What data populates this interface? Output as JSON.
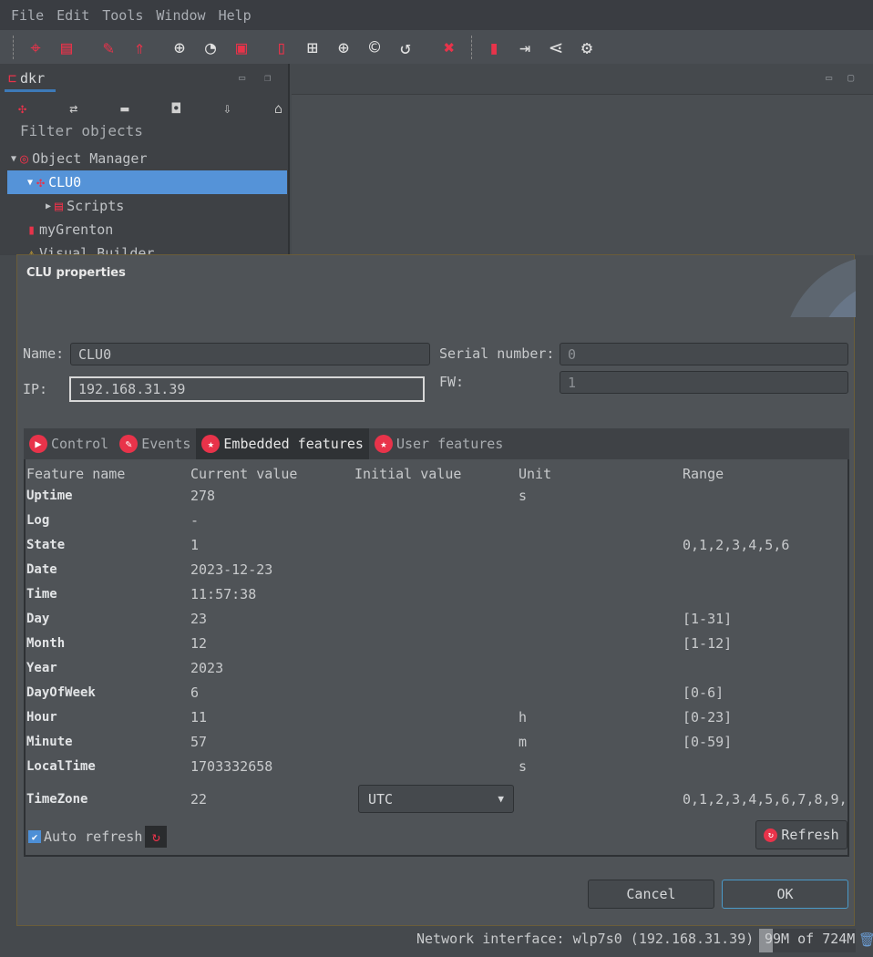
{
  "menu": [
    "File",
    "Edit",
    "Tools",
    "Window",
    "Help"
  ],
  "toolbar": {
    "icons": [
      "search-object-icon",
      "module-layout-icon",
      "pin-edit-icon",
      "upload-arrows-icon",
      "add-object-icon",
      "clock-icon",
      "add-script-icon",
      "mobile-refresh-icon",
      "object-tree-icon",
      "add-container-icon",
      "copyright-object-icon",
      "mobile-sync-icon",
      "delete-icon",
      "add-mobile-icon",
      "mobile-import-icon",
      "share-icon",
      "gear-icon"
    ]
  },
  "left_panel": {
    "tab": "dkr",
    "filter_placeholder": "Filter objects",
    "tree": [
      {
        "label": "Object Manager"
      },
      {
        "label": "CLU0"
      },
      {
        "label": "Scripts"
      },
      {
        "label": "myGrenton"
      },
      {
        "label": "Visual Builder"
      }
    ]
  },
  "dialog": {
    "title": "CLU properties",
    "name_label": "Name:",
    "name_value": "CLU0",
    "ip_label": "IP:",
    "ip_value": "192.168.31.39",
    "serial_label": "Serial number:",
    "serial_value": "0",
    "fw_label": "FW:",
    "fw_value": "1",
    "tabs": [
      {
        "label": "Control"
      },
      {
        "label": "Events"
      },
      {
        "label": "Embedded features",
        "active": true
      },
      {
        "label": "User features"
      }
    ],
    "columns": [
      "Feature name",
      "Current value",
      "Initial value",
      "Unit",
      "Range"
    ],
    "rows": [
      [
        "Uptime",
        "278",
        "",
        "s",
        ""
      ],
      [
        "Log",
        "-",
        "",
        "",
        ""
      ],
      [
        "State",
        "1",
        "",
        "",
        "0,1,2,3,4,5,6"
      ],
      [
        "Date",
        "2023-12-23",
        "",
        "",
        ""
      ],
      [
        "Time",
        "11:57:38",
        "",
        "",
        ""
      ],
      [
        "Day",
        "23",
        "",
        "",
        "[1-31]"
      ],
      [
        "Month",
        "12",
        "",
        "",
        "[1-12]"
      ],
      [
        "Year",
        "2023",
        "",
        "",
        ""
      ],
      [
        "DayOfWeek",
        "6",
        "",
        "",
        "[0-6]"
      ],
      [
        "Hour",
        "11",
        "",
        "h",
        "[0-23]"
      ],
      [
        "Minute",
        "57",
        "",
        "m",
        "[0-59]"
      ],
      [
        "LocalTime",
        "1703332658",
        "",
        "s",
        ""
      ]
    ],
    "timezone": {
      "name": "TimeZone",
      "current": "22",
      "initial_select": "UTC",
      "range": "0,1,2,3,4,5,6,7,8,9,"
    },
    "auto_refresh_label": "Auto refresh",
    "auto_refresh_checked": true,
    "refresh_label": "Refresh",
    "cancel_label": "Cancel",
    "ok_label": "OK"
  },
  "status": {
    "network": "Network interface: wlp7s0 (192.168.31.39)",
    "memory": "99M of 724M",
    "memory_fraction": 0.137
  }
}
